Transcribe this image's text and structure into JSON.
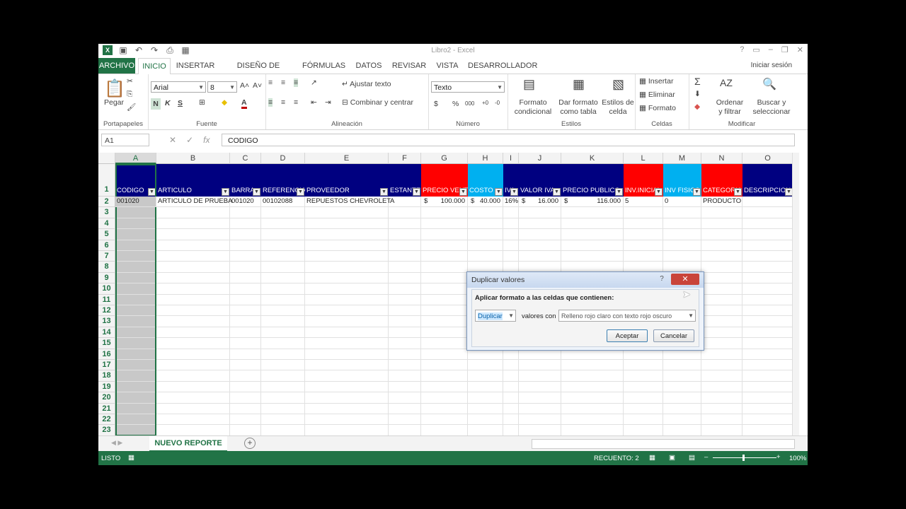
{
  "window": {
    "title": "Libro2 - Excel",
    "signin": "Iniciar sesión"
  },
  "tabs": [
    "ARCHIVO",
    "INICIO",
    "INSERTAR",
    "DISEÑO DE PÁGINA",
    "FÓRMULAS",
    "DATOS",
    "REVISAR",
    "VISTA",
    "DESARROLLADOR"
  ],
  "ribbon": {
    "portapapeles": {
      "paste": "Pegar",
      "label": "Portapapeles"
    },
    "fuente": {
      "font": "Arial",
      "size": "8",
      "bold": "N",
      "italic": "K",
      "underline": "S",
      "label": "Fuente"
    },
    "alineacion": {
      "wrap": "Ajustar texto",
      "merge": "Combinar y centrar",
      "label": "Alineación"
    },
    "numero": {
      "format": "Texto",
      "currency": "$",
      "percent": "%",
      "thousands": "000",
      "label": "Número"
    },
    "estilos": {
      "cond1": "Formato",
      "cond2": "condicional",
      "table1": "Dar formato",
      "table2": "como tabla",
      "cell1": "Estilos de",
      "cell2": "celda",
      "label": "Estilos"
    },
    "celdas": {
      "insert": "Insertar",
      "delete": "Eliminar",
      "format": "Formato",
      "label": "Celdas"
    },
    "modificar": {
      "sort1": "Ordenar",
      "sort2": "y filtrar",
      "find1": "Buscar y",
      "find2": "seleccionar",
      "label": "Modificar"
    }
  },
  "formula_bar": {
    "name_box": "A1",
    "fx": "fx",
    "value": "CODIGO"
  },
  "columns": [
    "A",
    "B",
    "C",
    "D",
    "E",
    "F",
    "G",
    "H",
    "I",
    "J",
    "K",
    "L",
    "M",
    "N",
    "O"
  ],
  "rows": [
    "1",
    "2",
    "3",
    "4",
    "5",
    "6",
    "7",
    "8",
    "9",
    "10",
    "11",
    "12",
    "13",
    "14",
    "15",
    "16",
    "17",
    "18",
    "19",
    "20",
    "21",
    "22",
    "23"
  ],
  "headers": [
    "CODIGO",
    "ARTICULO",
    "BARRA",
    "REFERENCIA",
    "PROVEEDOR",
    "ESTANTE",
    "PRECIO VENTA",
    "COSTO",
    "IVA",
    "VALOR IVA",
    "PRECIO PUBLICO",
    "INV.INICIAL",
    "INV FISICO",
    "CATEGORIA",
    "DESCRIPCION"
  ],
  "header_colors": [
    "#000080",
    "#000080",
    "#000080",
    "#000080",
    "#000080",
    "#000080",
    "#ff0000",
    "#00b0f0",
    "#000080",
    "#000080",
    "#000080",
    "#ff0000",
    "#00b0f0",
    "#ff0000",
    "#000080"
  ],
  "row2": [
    "001020",
    "ARTICULO DE PRUEBA",
    "001020",
    "00102088",
    "REPUESTOS CHEVROLET",
    "A",
    "$",
    "100.000",
    "$",
    "40.000",
    "16%",
    "$",
    "16.000",
    "$",
    "116.000",
    "5",
    "0",
    "PRODUCTO"
  ],
  "sheet": {
    "tab": "NUEVO REPORTE",
    "add": "+"
  },
  "status": {
    "mode": "LISTO",
    "count": "RECUENTO: 2",
    "zoom": "100%"
  },
  "dialog": {
    "title": "Duplicar valores",
    "prompt": "Aplicar formato a las celdas que contienen:",
    "type": "Duplicar",
    "with_label": "valores con",
    "format": "Relleno rojo claro con texto rojo oscuro",
    "ok": "Aceptar",
    "cancel": "Cancelar",
    "help": "?",
    "close": "✕"
  }
}
